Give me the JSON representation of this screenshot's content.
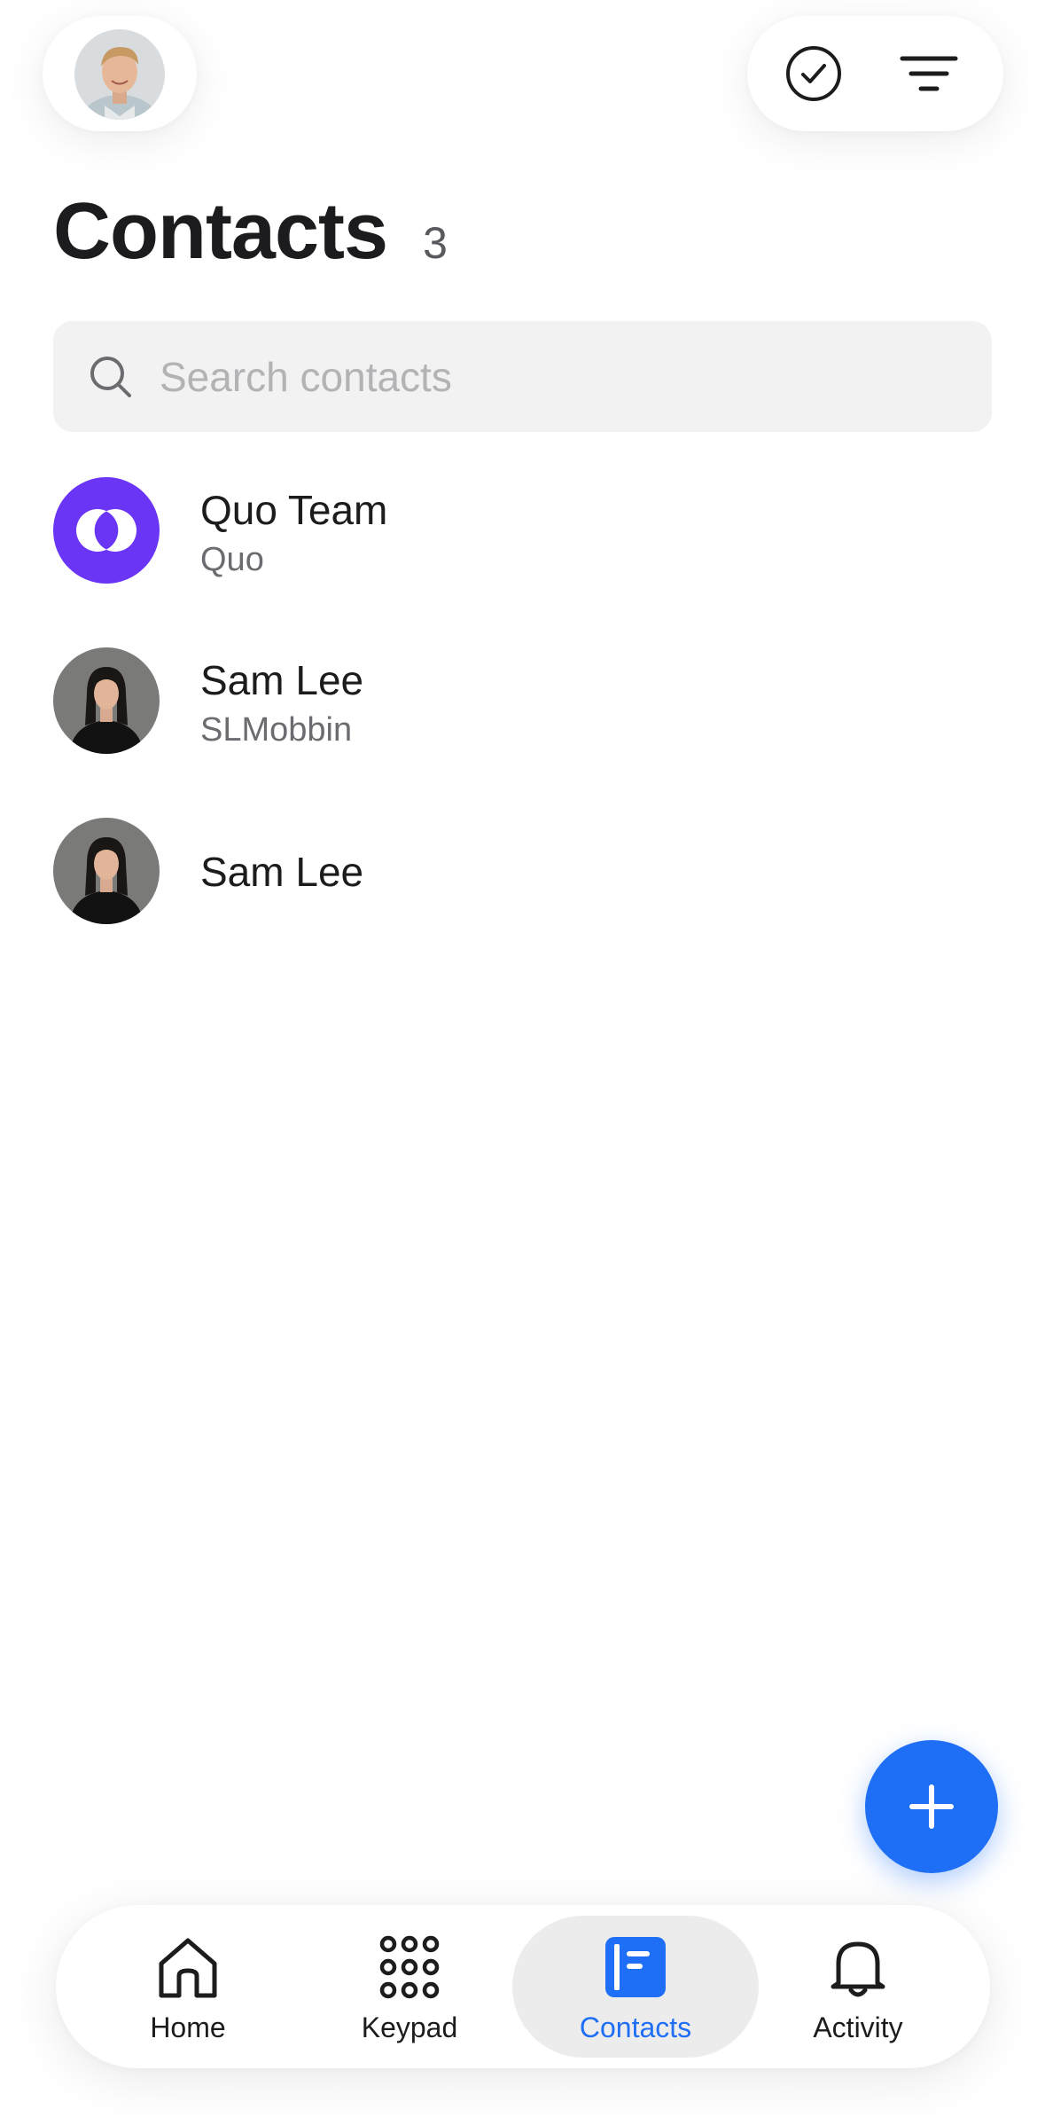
{
  "header": {
    "profile_avatar_icon": "user-avatar-photo",
    "check_icon": "check-circle-icon",
    "filter_icon": "filter-lines-icon"
  },
  "page": {
    "title": "Contacts",
    "count": "3"
  },
  "search": {
    "placeholder": "Search contacts",
    "value": "",
    "icon": "search-icon"
  },
  "contacts": [
    {
      "name": "Quo Team",
      "subtitle": "Quo",
      "avatar": "quo-logo",
      "avatar_color": "#6a35f5"
    },
    {
      "name": "Sam Lee",
      "subtitle": "SLMobbin",
      "avatar": "photo"
    },
    {
      "name": "Sam Lee",
      "subtitle": "",
      "avatar": "photo"
    }
  ],
  "fab": {
    "icon": "plus-icon",
    "color": "#1e6ff5"
  },
  "tabs": [
    {
      "label": "Home",
      "icon": "home-icon",
      "active": false
    },
    {
      "label": "Keypad",
      "icon": "keypad-icon",
      "active": false
    },
    {
      "label": "Contacts",
      "icon": "contacts-book-icon",
      "active": true
    },
    {
      "label": "Activity",
      "icon": "bell-icon",
      "active": false
    }
  ],
  "colors": {
    "accent": "#1e6ff5",
    "brand_purple": "#6a35f5",
    "active_tab_bg": "#ececec",
    "search_bg": "#f2f2f2"
  }
}
